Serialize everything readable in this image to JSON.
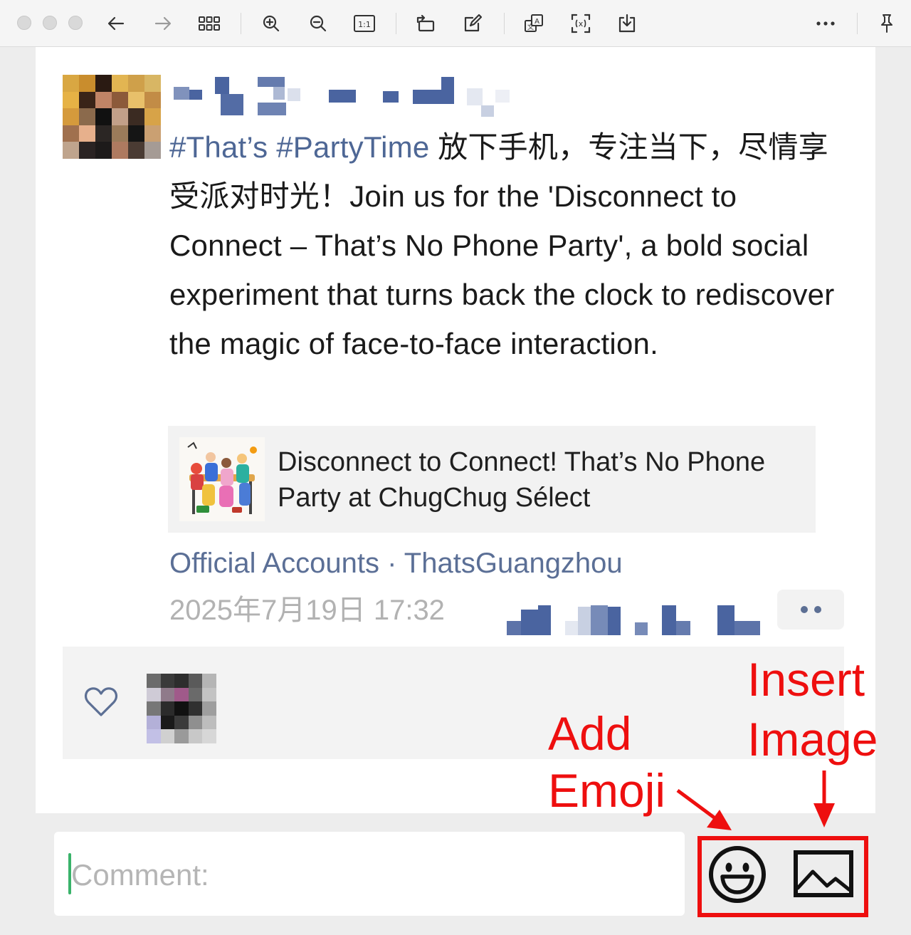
{
  "toolbar": {
    "icons": [
      "back-arrow-icon",
      "forward-arrow-icon",
      "grid-view-icon",
      "zoom-in-icon",
      "zoom-out-icon",
      "actual-size-icon",
      "rotate-icon",
      "edit-icon",
      "translate-icon",
      "scan-text-icon",
      "download-icon",
      "more-icon",
      "pin-icon"
    ]
  },
  "post": {
    "hashtags": "#That’s #PartyTime",
    "text_cn": " 放下手机，专注当下，尽情享受派对时光！",
    "text_en": "Join us for the 'Disconnect to Connect – That’s No Phone Party', a bold social experiment that turns back the clock to rediscover the magic of face-to-face interaction.",
    "link_card": {
      "title": "Disconnect to Connect! That’s No Phone Party at ChugChug Sélect"
    },
    "source": {
      "label": "Official Accounts",
      "separator": " · ",
      "account": "ThatsGuangzhou"
    },
    "timestamp": "2025年7月19日 17:32"
  },
  "comment": {
    "placeholder": "Comment:"
  },
  "annotations": {
    "add_emoji": "Add\nEmoji",
    "add_emoji_line1": "Add",
    "add_emoji_line2": "Emoji",
    "insert_image_line1": "Insert",
    "insert_image_line2": "Image",
    "color": "#ee0f0f"
  },
  "colors": {
    "link_blue": "#4e6795",
    "caret_green": "#39b36a",
    "annotation_red": "#ee0f0f"
  }
}
